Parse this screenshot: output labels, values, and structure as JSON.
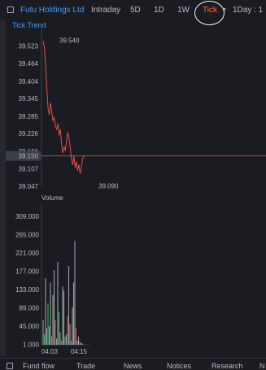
{
  "header": {
    "stock_name": "Futu Holdings Ltd",
    "tabs": [
      "Intraday",
      "5D",
      "1D",
      "1W",
      "Tick",
      "1Day : 1"
    ],
    "active_tab": "Tick",
    "dropdown_icon": "chevron-down-icon"
  },
  "tick_trend": {
    "title": "Tick Trend",
    "current_price": "39.150",
    "high_label": "39.540",
    "low_label": "39.090"
  },
  "volume": {
    "title": "Volume"
  },
  "chart_data": [
    {
      "type": "line",
      "title": "Tick Trend",
      "ylim": [
        39.047,
        39.583
      ],
      "yticks": [
        "39.523",
        "39.464",
        "39.404",
        "39.345",
        "39.285",
        "39.226",
        "39.166",
        "39.107",
        "39.047"
      ],
      "current_price": 39.15,
      "high": 39.54,
      "low": 39.09,
      "series": [
        {
          "color": "#e0504a",
          "values": [
            39.54,
            39.52,
            39.46,
            39.38,
            39.31,
            39.29,
            39.33,
            39.3,
            39.27,
            39.28,
            39.25,
            39.24,
            39.26,
            39.22,
            39.24,
            39.19,
            39.16,
            39.18,
            39.17,
            39.2,
            39.23,
            39.21,
            39.18,
            39.14,
            39.12,
            39.15,
            39.11,
            39.13,
            39.1,
            39.12,
            39.09,
            39.11,
            39.14,
            39.15
          ]
        }
      ]
    },
    {
      "type": "bar",
      "title": "Volume",
      "ylim": [
        0,
        331.0
      ],
      "yticks": [
        "309.000",
        "265.000",
        "221.000",
        "177.000",
        "133.000",
        "89.000",
        "45.000",
        "1.000"
      ],
      "xticks": [
        "04:03",
        "04:15"
      ],
      "values": [
        60,
        25,
        160,
        40,
        100,
        45,
        150,
        20,
        120,
        180,
        60,
        15,
        200,
        80,
        30,
        10,
        140,
        130,
        20,
        25,
        70,
        190,
        50,
        10,
        90,
        150,
        250,
        40,
        10,
        20,
        8,
        5,
        3
      ],
      "colors": [
        "#9aa0a6",
        "#2fb35b",
        "#9aa0a6",
        "#9aa0a6",
        "#2fb35b",
        "#9aa0a6",
        "#9aa0a6",
        "#2fb35b",
        "#9aa0a6",
        "#9aa0a6",
        "#e0504a",
        "#9aa0a6",
        "#9aa0a6",
        "#2fb35b",
        "#9aa0a6",
        "#e0504a",
        "#9aa0a6",
        "#9aa0a6",
        "#2fb35b",
        "#9aa0a6",
        "#e0504a",
        "#9aa0a6",
        "#9aa0a6",
        "#2fb35b",
        "#9aa0a6",
        "#9aa0a6",
        "#9aa0a6",
        "#e0504a",
        "#9aa0a6",
        "#9aa0a6",
        "#e0504a",
        "#9aa0a6",
        "#9aa0a6"
      ]
    }
  ],
  "bottom_tabs": [
    "Fund flow",
    "Trade",
    "News",
    "Notices",
    "Research",
    "N"
  ]
}
